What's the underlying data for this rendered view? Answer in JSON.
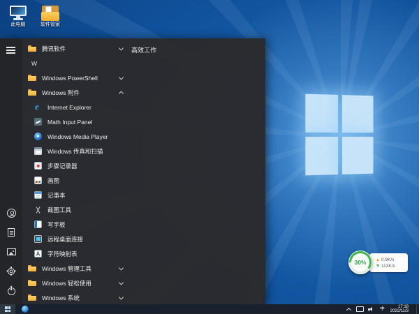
{
  "colors": {
    "desktop_blue": "#1a66b4",
    "start_menu_bg": "#2b2b2e",
    "taskbar_bg": "#18212d",
    "gauge_green": "#43b34e",
    "folder_yellow": "#f3b03f"
  },
  "desktop": {
    "icons": [
      {
        "label": "此电脑",
        "icon": "this-pc-icon"
      },
      {
        "label": "软件管家",
        "icon": "software-manager-icon"
      }
    ]
  },
  "start_menu": {
    "tile_group_header": "高效工作",
    "rail_icons": [
      "menu-icon",
      "user-icon",
      "documents-icon",
      "pictures-icon",
      "settings-icon",
      "power-icon"
    ],
    "items": [
      {
        "label": "腾讯软件",
        "type": "folder",
        "icon": "folder-icon",
        "chevron": "down"
      },
      {
        "label": "W",
        "type": "section-letter"
      },
      {
        "label": "Windows PowerShell",
        "type": "folder",
        "icon": "folder-icon",
        "chevron": "down"
      },
      {
        "label": "Windows 附件",
        "type": "folder",
        "icon": "folder-icon",
        "chevron": "up"
      },
      {
        "label": "Internet Explorer",
        "type": "app",
        "icon": "internet-explorer-icon"
      },
      {
        "label": "Math Input Panel",
        "type": "app",
        "icon": "math-input-panel-icon"
      },
      {
        "label": "Windows Media Player",
        "type": "app",
        "icon": "media-player-icon"
      },
      {
        "label": "Windows 传真和扫描",
        "type": "app",
        "icon": "fax-scan-icon"
      },
      {
        "label": "步骤记录器",
        "type": "app",
        "icon": "steps-recorder-icon"
      },
      {
        "label": "画图",
        "type": "app",
        "icon": "paint-icon"
      },
      {
        "label": "记事本",
        "type": "app",
        "icon": "notepad-icon"
      },
      {
        "label": "截图工具",
        "type": "app",
        "icon": "snipping-tool-icon"
      },
      {
        "label": "写字板",
        "type": "app",
        "icon": "wordpad-icon"
      },
      {
        "label": "远程桌面连接",
        "type": "app",
        "icon": "remote-desktop-icon"
      },
      {
        "label": "字符映射表",
        "type": "app",
        "icon": "character-map-icon"
      },
      {
        "label": "Windows 管理工具",
        "type": "folder",
        "icon": "folder-icon",
        "chevron": "down"
      },
      {
        "label": "Windows 轻松使用",
        "type": "folder",
        "icon": "folder-icon",
        "chevron": "down"
      },
      {
        "label": "Windows 系统",
        "type": "folder",
        "icon": "folder-icon",
        "chevron": "down"
      }
    ]
  },
  "speed_widget": {
    "percent": "30%",
    "upload_speed": "0.9K/s",
    "download_speed": "113K/s"
  },
  "taskbar": {
    "time": "17:18",
    "date": "2022/11/3",
    "ime": "中",
    "tray_icons": [
      "chevron-up-icon",
      "network-icon",
      "volume-icon"
    ]
  }
}
